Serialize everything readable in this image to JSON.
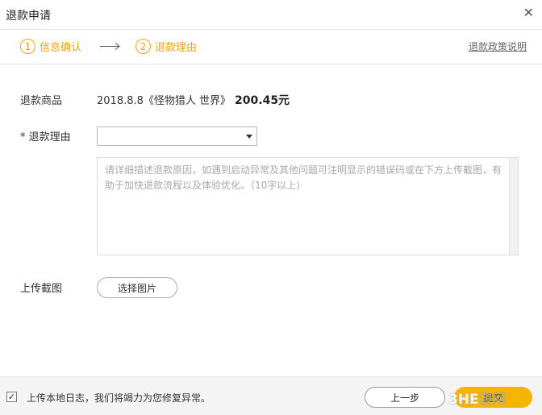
{
  "window": {
    "title": "退款申请",
    "close_icon": "close-icon"
  },
  "steps": [
    {
      "number": "1",
      "label": "信息确认"
    },
    {
      "number": "2",
      "label": "退款理由"
    }
  ],
  "policy_link": "退款政策说明",
  "form": {
    "product_label": "退款商品",
    "product_name": "2018.8.8《怪物猎人 世界》",
    "product_price": "200.45元",
    "reason_label": "* 退款理由",
    "reason_selected": "",
    "description_placeholder": "请详细描述退款原因，如遇到启动异常及其他问题可注明显示的错误码或在下方上传截图，有助于加快退款流程以及体验优化。（10字以上）",
    "upload_label": "上传截图",
    "upload_button": "选择图片"
  },
  "footer": {
    "upload_log_checked": true,
    "upload_log_text": "上传本地日志，我们将竭力为您修复异常。",
    "prev_button": "上一步",
    "submit_button": "提交"
  },
  "watermark": {
    "text_a": "3HE",
    "text_b": "游网"
  },
  "colors": {
    "accent": "#f0a30a",
    "submit": "#f5b400"
  }
}
